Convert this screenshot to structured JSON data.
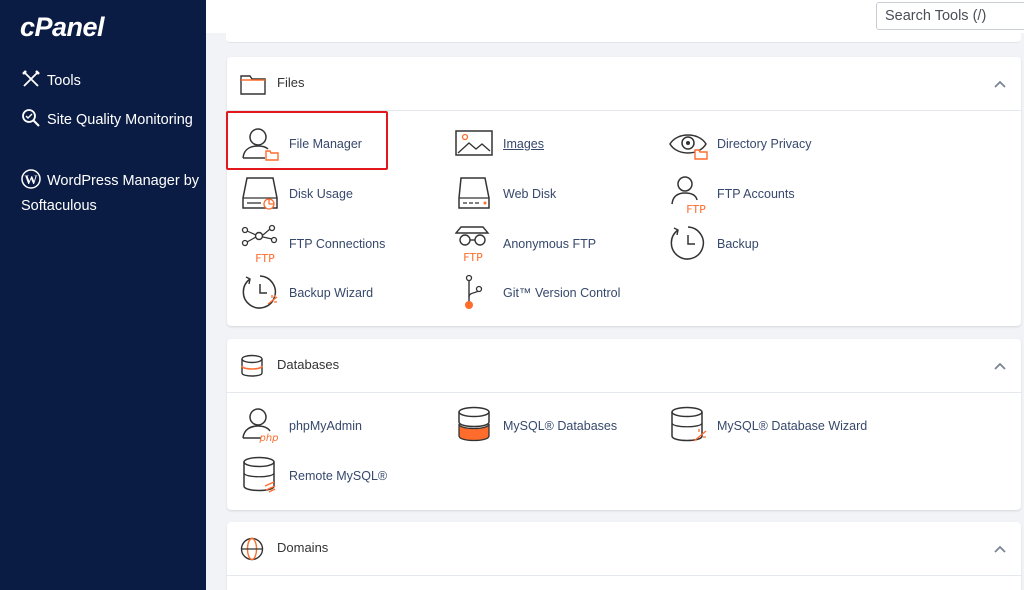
{
  "sidebar": {
    "logo": "cPanel",
    "items": [
      {
        "label": "Tools",
        "icon": "tools-icon"
      },
      {
        "label": "Site Quality Monitoring",
        "icon": "magnifier-icon"
      },
      {
        "label": "WordPress Manager by Softaculous",
        "icon": "wordpress-icon"
      }
    ]
  },
  "search": {
    "placeholder": "Search Tools (/)"
  },
  "sections": [
    {
      "title": "Files",
      "items": [
        {
          "label": "File Manager",
          "icon": "file-manager-icon",
          "highlighted": true
        },
        {
          "label": "Images",
          "icon": "images-icon",
          "link": true
        },
        {
          "label": "Directory Privacy",
          "icon": "directory-privacy-icon"
        },
        {
          "label": "Disk Usage",
          "icon": "disk-usage-icon"
        },
        {
          "label": "Web Disk",
          "icon": "web-disk-icon"
        },
        {
          "label": "FTP Accounts",
          "icon": "ftp-accounts-icon",
          "badge": "FTP"
        },
        {
          "label": "FTP Connections",
          "icon": "ftp-connections-icon",
          "badge": "FTP"
        },
        {
          "label": "Anonymous FTP",
          "icon": "anonymous-ftp-icon",
          "badge": "FTP"
        },
        {
          "label": "Backup",
          "icon": "backup-icon"
        },
        {
          "label": "Backup Wizard",
          "icon": "backup-wizard-icon"
        },
        {
          "label": "Git™ Version Control",
          "icon": "git-icon"
        }
      ]
    },
    {
      "title": "Databases",
      "items": [
        {
          "label": "phpMyAdmin",
          "icon": "phpmyadmin-icon",
          "badge": "php"
        },
        {
          "label": "MySQL® Databases",
          "icon": "mysql-databases-icon"
        },
        {
          "label": "MySQL® Database Wizard",
          "icon": "mysql-wizard-icon"
        },
        {
          "label": "Remote MySQL®",
          "icon": "remote-mysql-icon"
        }
      ]
    },
    {
      "title": "Domains",
      "items": []
    }
  ],
  "colors": {
    "sidebar": "#0b1c44",
    "accent": "#ff6c2c",
    "label": "#36486b",
    "highlight": "#e3181c"
  }
}
